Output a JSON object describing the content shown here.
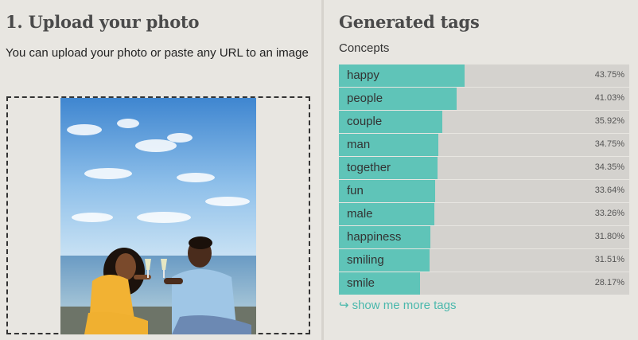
{
  "upload": {
    "title": "1. Upload your photo",
    "description": "You can upload your photo or paste any URL to an image"
  },
  "tags_panel": {
    "title": "Generated tags",
    "subheading": "Concepts",
    "more_link": "show me more tags",
    "more_icon": "return-arrow-icon",
    "accent_color": "#5fc4b8",
    "tags": [
      {
        "label": "happy",
        "percent": "43.75%",
        "value": 0.4375
      },
      {
        "label": "people",
        "percent": "41.03%",
        "value": 0.4103
      },
      {
        "label": "couple",
        "percent": "35.92%",
        "value": 0.3592
      },
      {
        "label": "man",
        "percent": "34.75%",
        "value": 0.3475
      },
      {
        "label": "together",
        "percent": "34.35%",
        "value": 0.3435
      },
      {
        "label": "fun",
        "percent": "33.64%",
        "value": 0.3364
      },
      {
        "label": "male",
        "percent": "33.26%",
        "value": 0.3326
      },
      {
        "label": "happiness",
        "percent": "31.80%",
        "value": 0.318
      },
      {
        "label": "smiling",
        "percent": "31.51%",
        "value": 0.3151
      },
      {
        "label": "smile",
        "percent": "28.17%",
        "value": 0.2817
      }
    ]
  }
}
